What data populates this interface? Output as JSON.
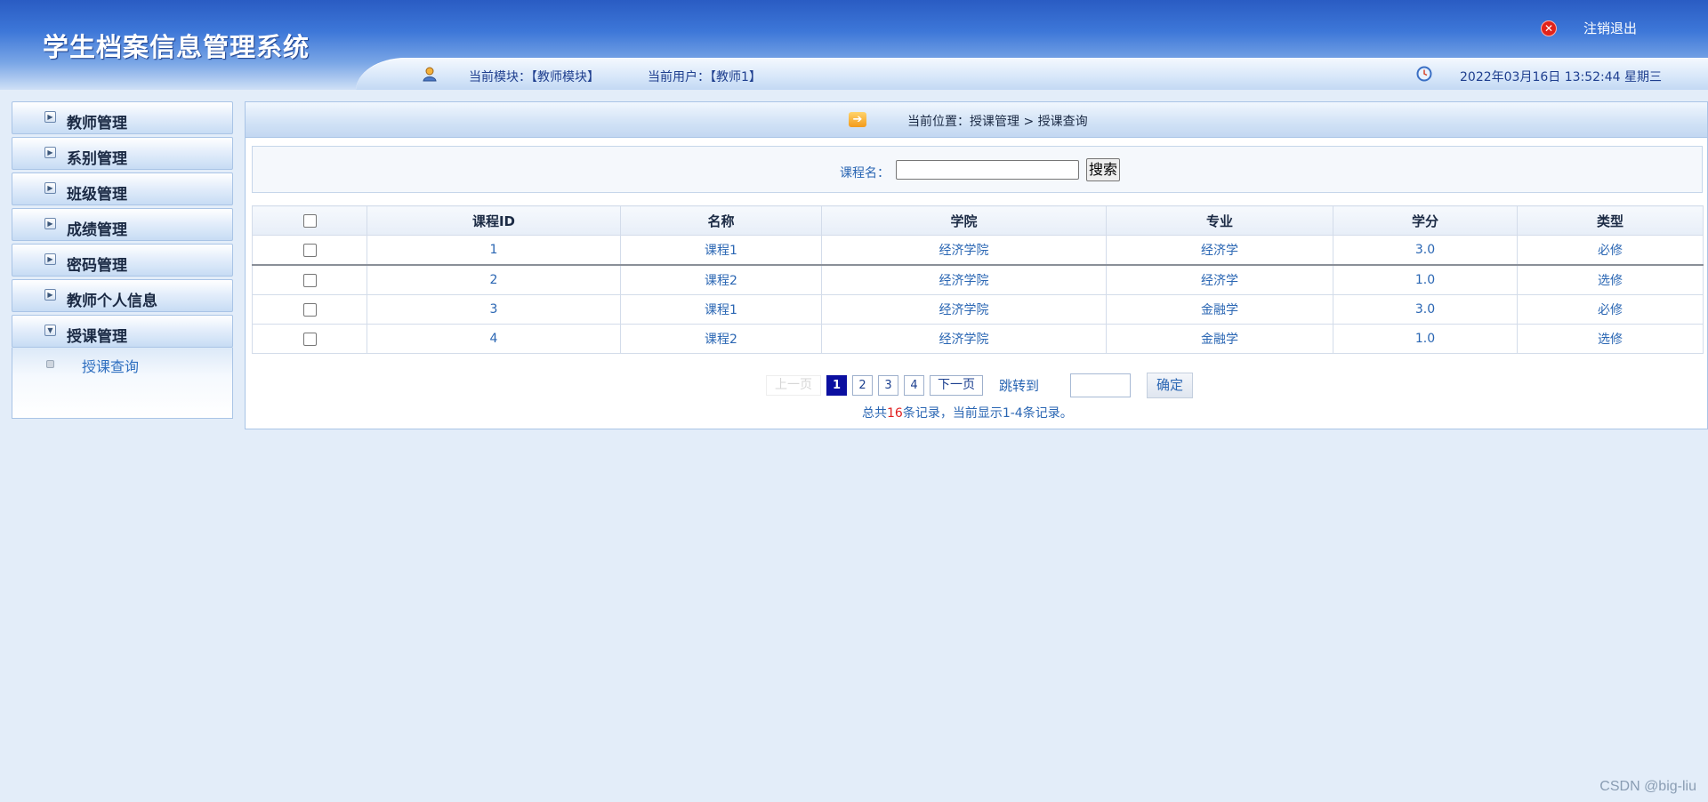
{
  "header": {
    "app_title": "学生档案信息管理系统",
    "logout_label": "注销退出",
    "current_module_text": "当前模块：【教师模块】",
    "current_user_text": "当前用户：【教师1】",
    "datetime_text": "2022年03月16日 13:52:44 星期三"
  },
  "sidebar": {
    "items": [
      {
        "label": "教师管理",
        "icon": "collapsed-arrow-icon"
      },
      {
        "label": "系别管理",
        "icon": "collapsed-arrow-icon"
      },
      {
        "label": "班级管理",
        "icon": "collapsed-arrow-icon"
      },
      {
        "label": "成绩管理",
        "icon": "collapsed-arrow-icon"
      },
      {
        "label": "密码管理",
        "icon": "collapsed-arrow-icon"
      },
      {
        "label": "教师个人信息",
        "icon": "collapsed-arrow-icon"
      },
      {
        "label": "授课管理",
        "icon": "expanded-arrow-icon"
      }
    ],
    "submenu": {
      "items": [
        {
          "label": "授课查询"
        }
      ]
    }
  },
  "main": {
    "breadcrumb_text": "当前位置：授课管理 > 授课查询",
    "search": {
      "label": "课程名：",
      "value": "",
      "button_label": "搜索"
    },
    "table": {
      "columns": [
        "课程ID",
        "名称",
        "学院",
        "专业",
        "学分",
        "类型"
      ],
      "rows": [
        {
          "id": "1",
          "name": "课程1",
          "college": "经济学院",
          "major": "经济学",
          "credit": "3.0",
          "type": "必修"
        },
        {
          "id": "2",
          "name": "课程2",
          "college": "经济学院",
          "major": "经济学",
          "credit": "1.0",
          "type": "选修"
        },
        {
          "id": "3",
          "name": "课程1",
          "college": "经济学院",
          "major": "金融学",
          "credit": "3.0",
          "type": "必修"
        },
        {
          "id": "4",
          "name": "课程2",
          "college": "经济学院",
          "major": "金融学",
          "credit": "1.0",
          "type": "选修"
        }
      ]
    },
    "pagination": {
      "prev_label": "上一页",
      "pages": [
        "1",
        "2",
        "3",
        "4"
      ],
      "current_page": "1",
      "next_label": "下一页",
      "jump_label": "跳转到",
      "jump_value": "",
      "confirm_label": "确定",
      "summary_prefix": "总共",
      "summary_count": "16",
      "summary_suffix": "条记录，当前显示1-4条记录。"
    }
  },
  "watermark": "CSDN @big-liu",
  "colors": {
    "header_blue": "#2a5cc3",
    "link_blue": "#2a66b3",
    "active_page": "#0b0fa0",
    "count_red": "#e02020",
    "page_bg": "#e3edf9"
  }
}
